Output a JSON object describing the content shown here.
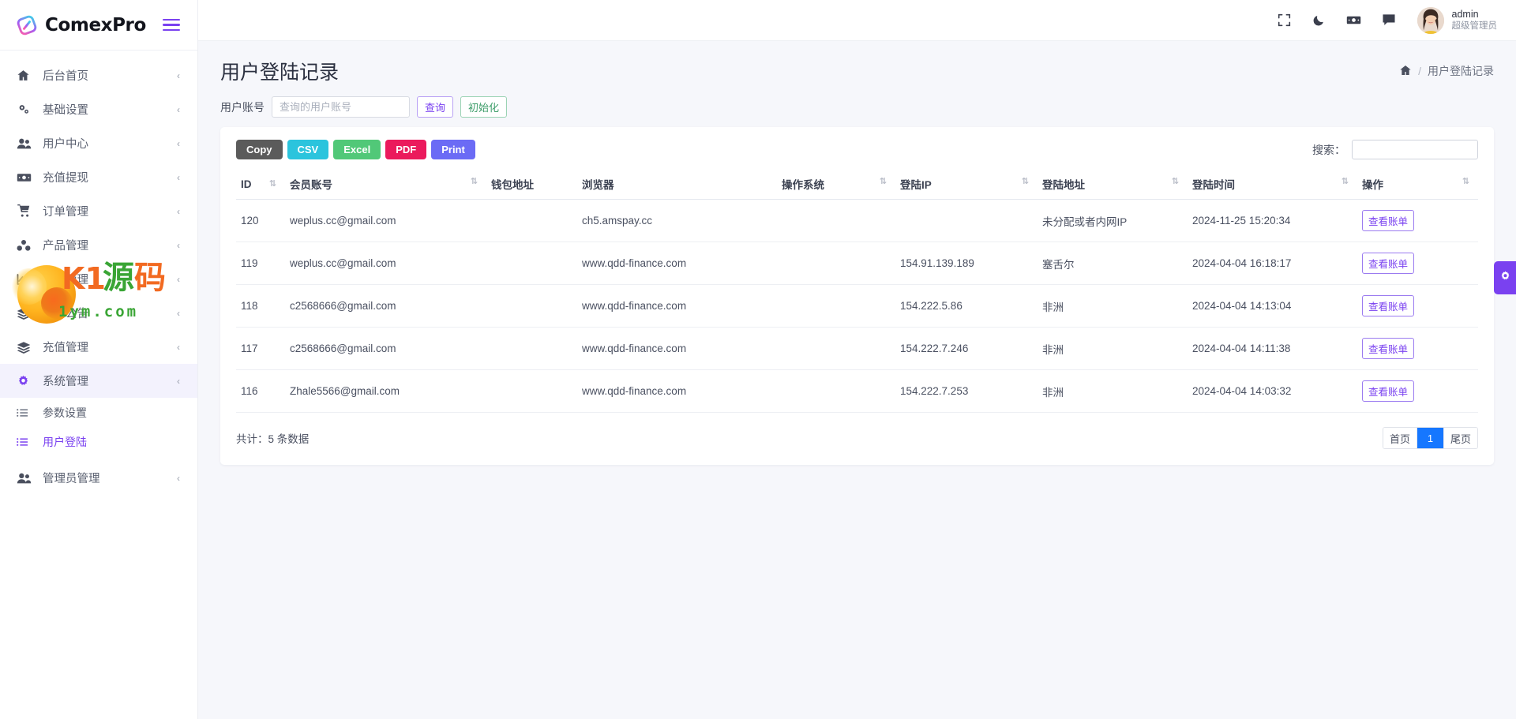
{
  "brand": {
    "name": "ComexPro",
    "logo_icon": "comexpro-logo",
    "menu_toggle_icon": "hamburger-icon"
  },
  "sidebar": {
    "items": [
      {
        "label": "后台首页",
        "icon": "home-icon",
        "chevron": "‹"
      },
      {
        "label": "基础设置",
        "icon": "gears-icon",
        "chevron": "‹"
      },
      {
        "label": "用户中心",
        "icon": "users-icon",
        "chevron": "‹"
      },
      {
        "label": "充值提现",
        "icon": "money-icon",
        "chevron": "‹"
      },
      {
        "label": "订单管理",
        "icon": "cart-icon",
        "chevron": "‹"
      },
      {
        "label": "产品管理",
        "icon": "cubes-icon",
        "chevron": "‹"
      },
      {
        "label": "风控管理",
        "icon": "chart-line-icon",
        "chevron": "‹"
      },
      {
        "label": "文章公告",
        "icon": "layers-icon",
        "chevron": "‹"
      },
      {
        "label": "充值管理",
        "icon": "stack-icon",
        "chevron": "‹"
      },
      {
        "label": "系统管理",
        "icon": "cog-icon",
        "chevron": "‹"
      }
    ],
    "submenu": [
      {
        "label": "参数设置",
        "icon": "list-icon",
        "selected": false
      },
      {
        "label": "用户登陆",
        "icon": "list-icon",
        "selected": true
      }
    ],
    "last_item": {
      "label": "管理员管理",
      "icon": "user-group-icon",
      "chevron": "‹"
    }
  },
  "topbar": {
    "icons": [
      {
        "name": "fullscreen-icon",
        "glyph": "fullscreen"
      },
      {
        "name": "dark-mode-icon",
        "glyph": "moon"
      },
      {
        "name": "cash-icon",
        "glyph": "money"
      },
      {
        "name": "message-icon",
        "glyph": "comment"
      }
    ],
    "user": {
      "name": "admin",
      "role": "超级管理员",
      "avatar": "user-avatar"
    }
  },
  "page": {
    "title": "用户登陆记录",
    "breadcrumb": {
      "home_icon": "home-icon",
      "separator": "/",
      "current": "用户登陆记录"
    }
  },
  "filter": {
    "label": "用户账号",
    "placeholder": "查询的用户账号",
    "value": "",
    "query_button": "查询",
    "reset_button": "初始化"
  },
  "export_buttons": [
    {
      "label": "Copy",
      "color": "#5b5b5b"
    },
    {
      "label": "CSV",
      "color": "#2bc4dd"
    },
    {
      "label": "Excel",
      "color": "#51c878"
    },
    {
      "label": "PDF",
      "color": "#eb1a5c"
    },
    {
      "label": "Print",
      "color": "#6b6bf5"
    }
  ],
  "table_search": {
    "label": "搜索：",
    "placeholder": "",
    "value": ""
  },
  "table": {
    "columns": [
      {
        "label": "ID",
        "sortable": true
      },
      {
        "label": "会员账号",
        "sortable": true
      },
      {
        "label": "钱包地址",
        "sortable": false
      },
      {
        "label": "浏览器",
        "sortable": false
      },
      {
        "label": "操作系统",
        "sortable": true
      },
      {
        "label": "登陆IP",
        "sortable": true
      },
      {
        "label": "登陆地址",
        "sortable": true
      },
      {
        "label": "登陆时间",
        "sortable": true
      },
      {
        "label": "操作",
        "sortable": true
      }
    ],
    "rows": [
      {
        "id": "120",
        "account": "weplus.cc@gmail.com",
        "wallet": "",
        "browser": "ch5.amspay.cc",
        "os": "",
        "ip": "",
        "location": "未分配或者内网IP",
        "time": "2024-11-25 15:20:34",
        "action": "查看账单"
      },
      {
        "id": "119",
        "account": "weplus.cc@gmail.com",
        "wallet": "",
        "browser": "www.qdd-finance.com",
        "os": "",
        "ip": "154.91.139.189",
        "location": "塞舌尔",
        "time": "2024-04-04 16:18:17",
        "action": "查看账单"
      },
      {
        "id": "118",
        "account": "c2568666@gmail.com",
        "wallet": "",
        "browser": "www.qdd-finance.com",
        "os": "",
        "ip": "154.222.5.86",
        "location": "非洲",
        "time": "2024-04-04 14:13:04",
        "action": "查看账单"
      },
      {
        "id": "117",
        "account": "c2568666@gmail.com",
        "wallet": "",
        "browser": "www.qdd-finance.com",
        "os": "",
        "ip": "154.222.7.246",
        "location": "非洲",
        "time": "2024-04-04 14:11:38",
        "action": "查看账单"
      },
      {
        "id": "116",
        "account": "Zhale5566@gmail.com",
        "wallet": "",
        "browser": "www.qdd-finance.com",
        "os": "",
        "ip": "154.222.7.253",
        "location": "非洲",
        "time": "2024-04-04 14:03:32",
        "action": "查看账单"
      }
    ]
  },
  "footer": {
    "total_text": "共计：5 条数据",
    "pagination": {
      "first": "首页",
      "current": "1",
      "last": "尾页"
    }
  },
  "float_gear": {
    "icon": "gear-icon"
  },
  "watermark": {
    "k1": "K1",
    "cn_source": "源",
    "cn_code": "码",
    "domain": "1ym.com"
  },
  "colors": {
    "accent": "#7a41f0",
    "page_active": "#1677ff"
  }
}
